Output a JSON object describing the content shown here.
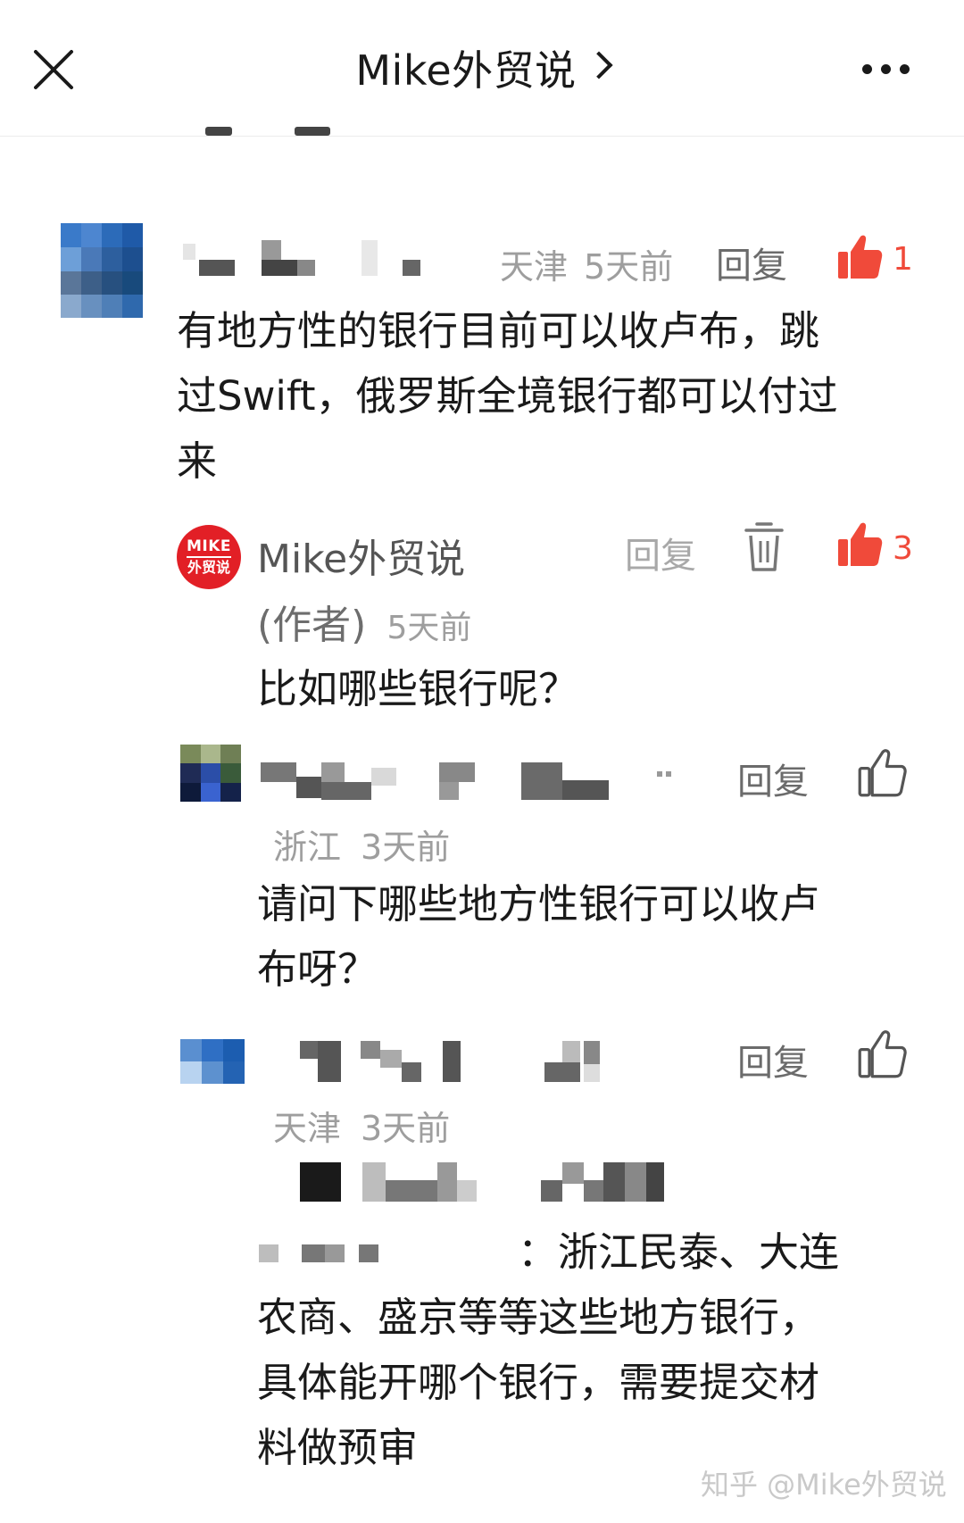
{
  "header": {
    "title": "Mike外贸说"
  },
  "comments": [
    {
      "location": "天津",
      "time": "5天前",
      "reply_label": "回复",
      "like_count": "1",
      "lines": [
        "有地方性的银行目前可以收卢布，跳",
        "过Swift，俄罗斯全境银行都可以付过",
        "来"
      ]
    }
  ],
  "author_reply": {
    "logo_line1": "MIKE",
    "logo_line2": "外贸说",
    "name": "Mike外贸说",
    "role": "(作者)",
    "time": "5天前",
    "reply_label": "回复",
    "like_count": "3",
    "text": "比如哪些银行呢？"
  },
  "replies": [
    {
      "location": "浙江",
      "time": "3天前",
      "reply_label": "回复",
      "lines": [
        "请问下哪些地方性银行可以收卢",
        "布呀？"
      ]
    },
    {
      "location": "天津",
      "time": "3天前",
      "reply_label": "回复",
      "lines": [
        "：浙江民泰、大连",
        "农商、盛京等等这些地方银行，",
        "具体能开哪个银行，需要提交材",
        "料做预审"
      ]
    }
  ],
  "watermark": "知乎 @Mike外贸说",
  "colors": {
    "like_red": "#f04a3a",
    "brand_red": "#e21f26",
    "meta_gray": "#9e9e9e"
  }
}
